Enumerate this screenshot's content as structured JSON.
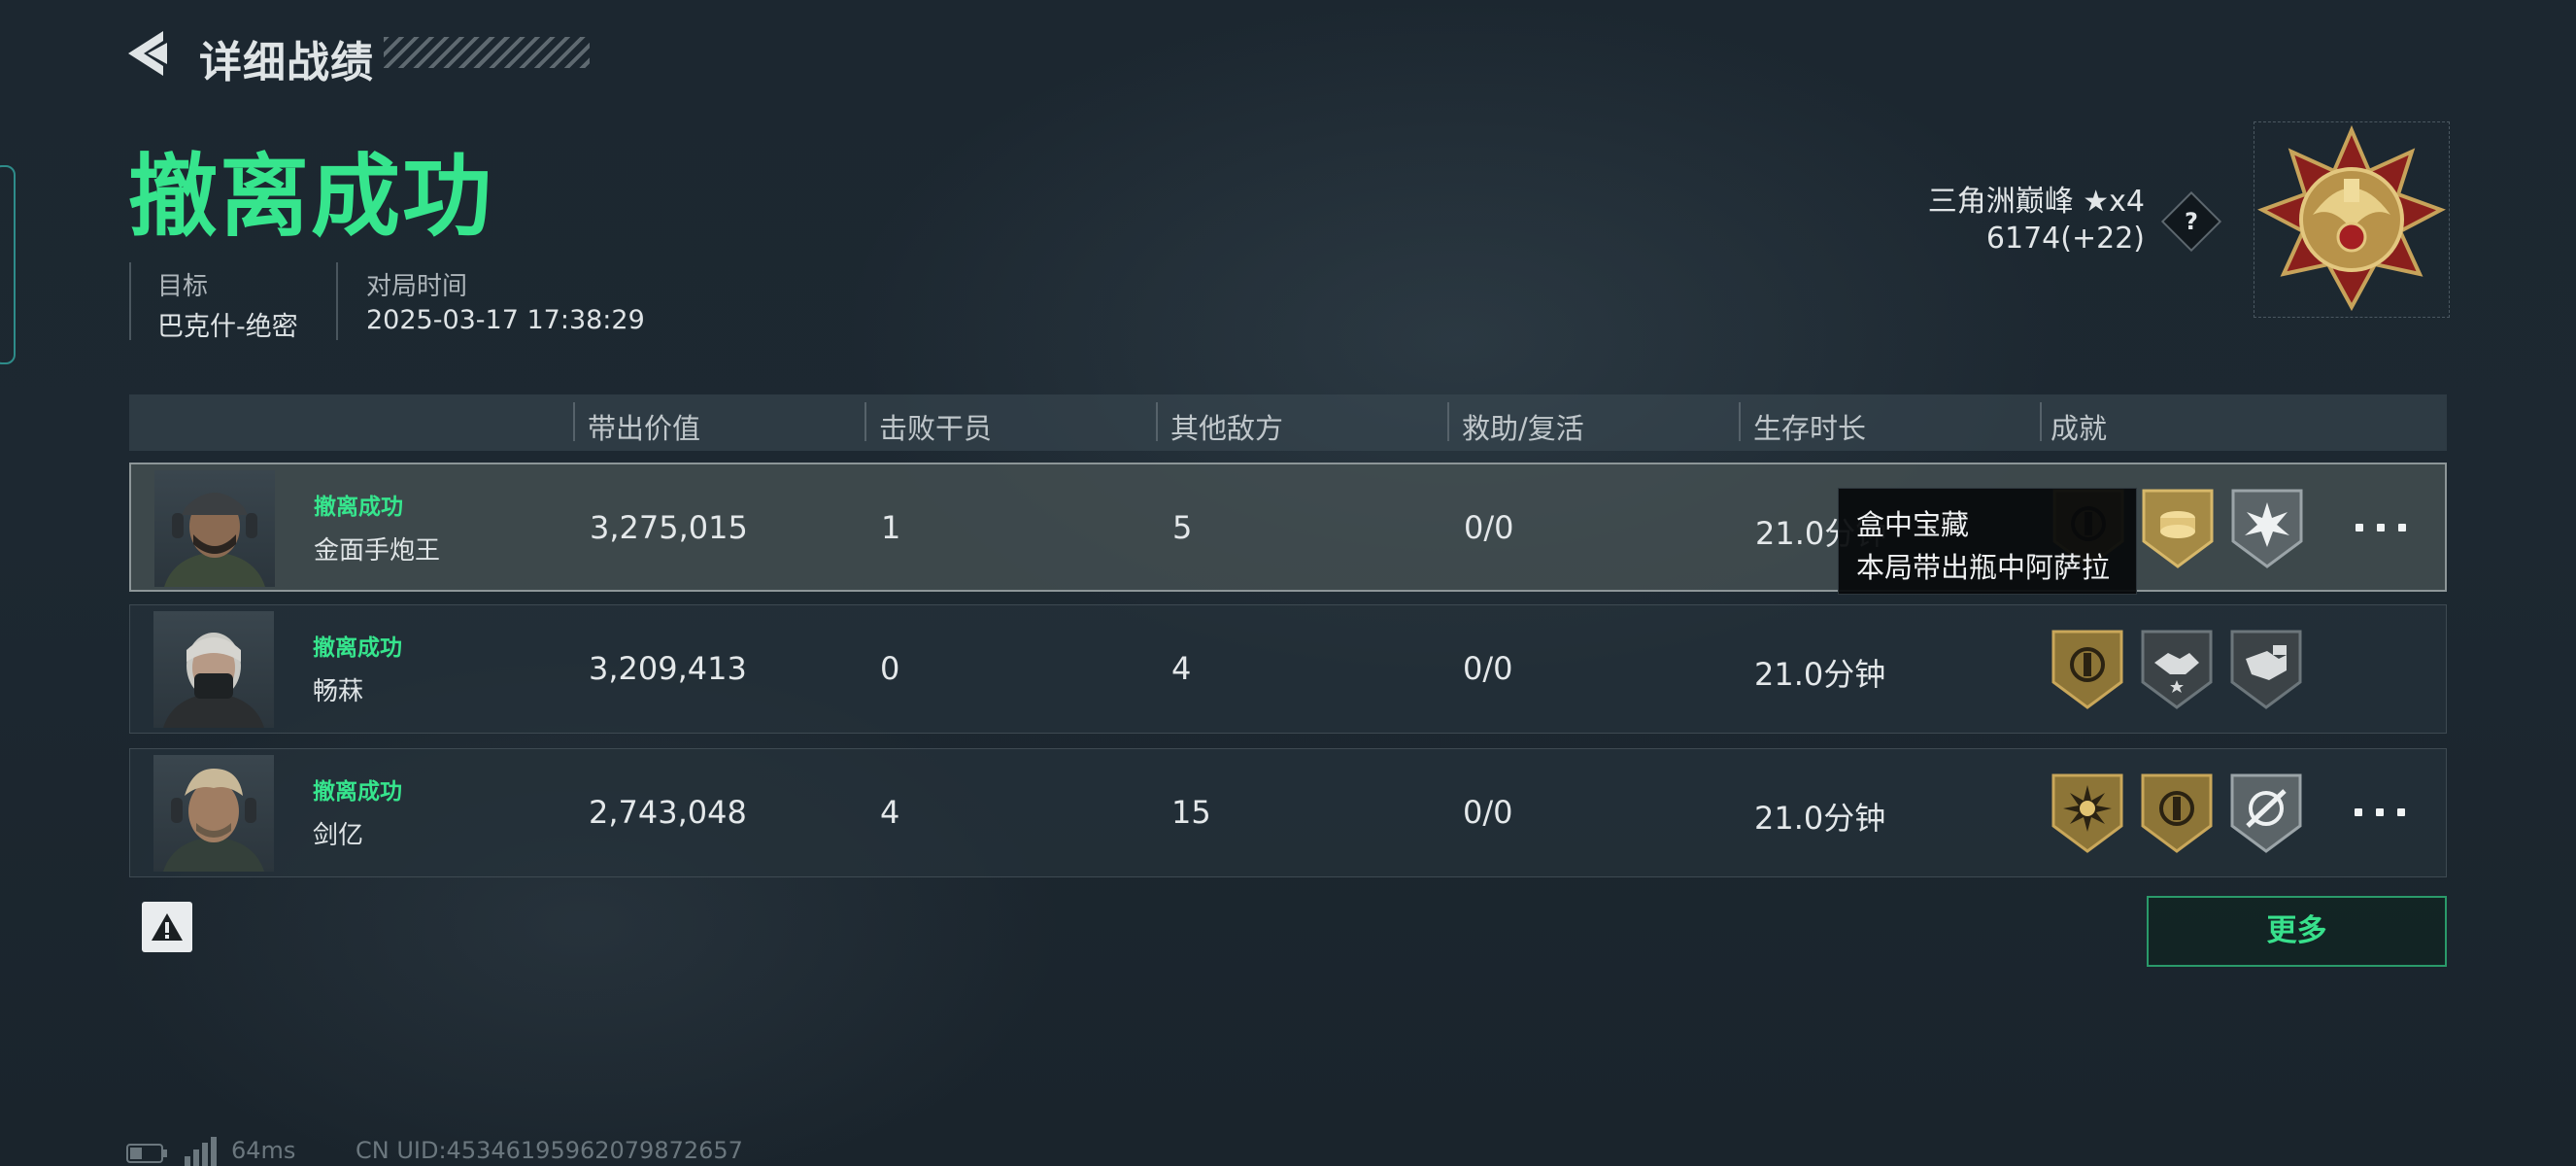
{
  "header": {
    "title": "详细战绩"
  },
  "result": {
    "status": "撤离成功"
  },
  "meta": {
    "target_label": "目标",
    "target_value": "巴克什-绝密",
    "time_label": "对局时间",
    "time_value": "2025-03-17 17:38:29"
  },
  "rank": {
    "name": "三角洲巅峰 ★x4",
    "score": "6174(+22)",
    "help": "?"
  },
  "table": {
    "columns": [
      "带出价值",
      "击败干员",
      "其他敌方",
      "救助/复活",
      "生存时长",
      "成就"
    ],
    "rows": [
      {
        "status": "撤离成功",
        "name": "金面手炮王",
        "value": "3,275,015",
        "kills": "1",
        "others": "5",
        "assists": "0/0",
        "time": "21.0分钟",
        "achievements": [
          "safe-medal-icon",
          "coin-stack-medal-icon",
          "burst-medal-icon"
        ]
      },
      {
        "status": "撤离成功",
        "name": "畅菻",
        "value": "3,209,413",
        "kills": "0",
        "others": "4",
        "assists": "0/0",
        "time": "21.0分钟",
        "achievements": [
          "safe-medal-icon",
          "handshake-medal-icon",
          "deal-medal-icon"
        ]
      },
      {
        "status": "撤离成功",
        "name": "剑亿",
        "value": "2,743,048",
        "kills": "4",
        "others": "15",
        "assists": "0/0",
        "time": "21.0分钟",
        "achievements": [
          "sun-medal-icon",
          "safe-medal-icon",
          "target-medal-icon"
        ]
      }
    ]
  },
  "tooltip": {
    "title": "盒中宝藏",
    "desc": "本局带出瓶中阿萨拉"
  },
  "buttons": {
    "more": "更多"
  },
  "footer": {
    "ping": "64ms",
    "uid": "CN UID:4534619596207987265​7"
  },
  "colors": {
    "accent_green": "#36e58d",
    "gold": "#b99a52",
    "silver": "#8e979b"
  }
}
